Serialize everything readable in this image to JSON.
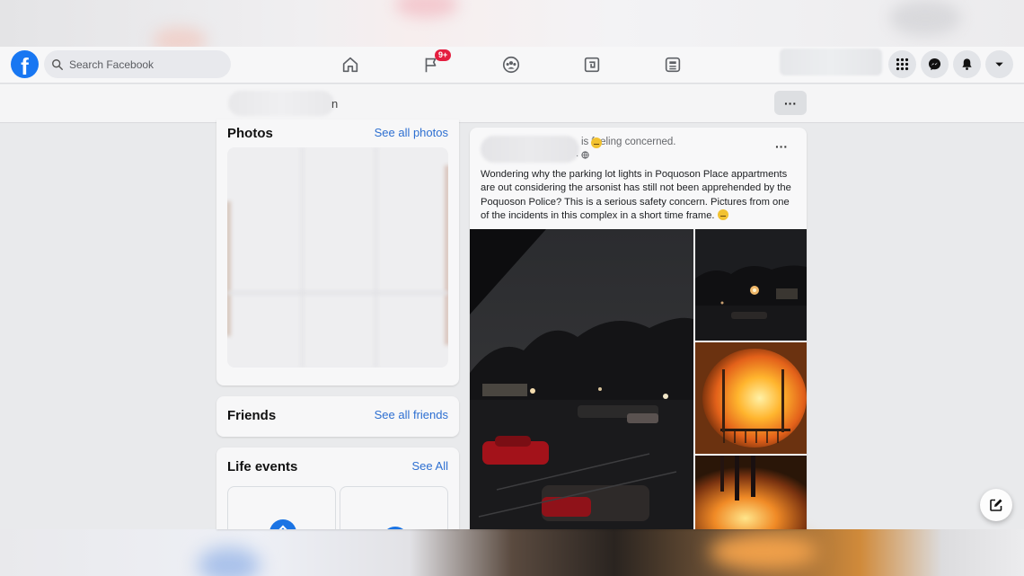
{
  "nav": {
    "logo_letter": "f",
    "search_placeholder": "Search Facebook",
    "notification_badge": "9+",
    "icons": [
      "home-icon",
      "pages-flag-icon",
      "groups-icon",
      "gaming-icon",
      "news-icon"
    ]
  },
  "account": {
    "menu_icon": "grid-menu-icon",
    "messenger_icon": "messenger-icon",
    "notifications_icon": "bell-icon",
    "account_icon": "chevron-down-icon"
  },
  "profile": {
    "name_tail": "n",
    "more_label": "···"
  },
  "photos_card": {
    "title": "Photos",
    "link": "See all photos"
  },
  "friends_card": {
    "title": "Friends",
    "link": "See all friends"
  },
  "life_events_card": {
    "title": "Life events",
    "link": "See All"
  },
  "post": {
    "feeling": "is  feeling concerned.",
    "meta": "· ",
    "more_label": "···",
    "text": "Wondering why the parking lot lights in Poquoson Place appartments are out considering the arsonist has still not been apprehended by the Poquoson Police? This is a serious safety concern. Pictures from one of the incidents in this complex in a short time frame.",
    "photos": [
      "parking-lot-night-photo",
      "night-building-photo",
      "fire-balcony-photo",
      "fire-close-photo"
    ]
  },
  "colors": {
    "brand": "#1877f2",
    "link": "#2d6fd1",
    "badge": "#e41e3f"
  }
}
